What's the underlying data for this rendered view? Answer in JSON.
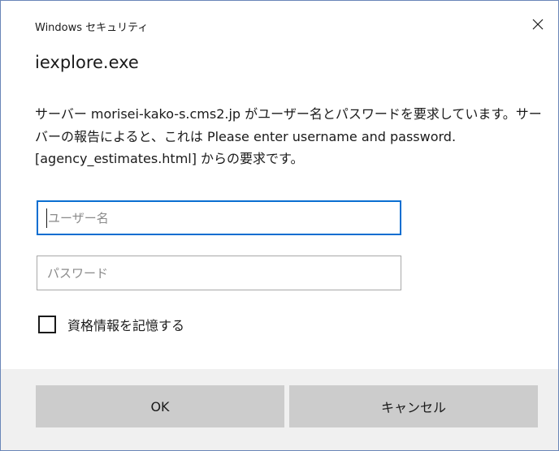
{
  "titlebar": {
    "title": "Windows セキュリティ",
    "close_icon": "close-icon"
  },
  "heading": "iexplore.exe",
  "message": "サーバー morisei-kako-s.cms2.jp がユーザー名とパスワードを要求しています。サーバーの報告によると、これは Please enter username and password. [agency_estimates.html] からの要求です。",
  "fields": {
    "username_placeholder": "ユーザー名",
    "username_value": "",
    "password_placeholder": "パスワード",
    "password_value": ""
  },
  "remember": {
    "label": "資格情報を記憶する",
    "checked": false
  },
  "buttons": {
    "ok": "OK",
    "cancel": "キャンセル"
  },
  "colors": {
    "focus_border": "#0a6ed1",
    "window_border": "#6a86b8",
    "button_bg": "#cccccc",
    "footer_bg": "#f0f0f0"
  }
}
